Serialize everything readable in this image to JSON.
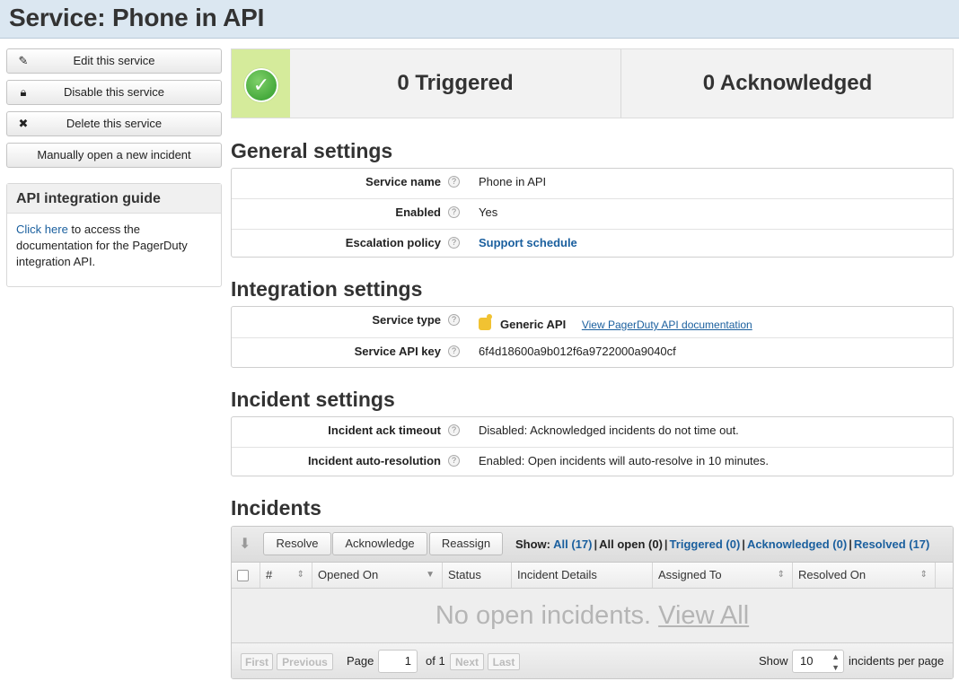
{
  "page": {
    "title": "Service: Phone in API"
  },
  "sidebar": {
    "actions": [
      {
        "label": "Edit this service",
        "icon": "pencil-icon"
      },
      {
        "label": "Disable this service",
        "icon": "lock-icon"
      },
      {
        "label": "Delete this service",
        "icon": "x-icon"
      },
      {
        "label": "Manually open a new incident",
        "icon": ""
      }
    ],
    "guide": {
      "title": "API integration guide",
      "link_text": "Click here",
      "text": " to access the documentation for the PagerDuty integration API."
    }
  },
  "status": {
    "icon": "checkmark-icon",
    "triggered": "0 Triggered",
    "acknowledged": "0 Acknowledged"
  },
  "general": {
    "heading": "General settings",
    "rows": [
      {
        "label": "Service name",
        "value": "Phone in API"
      },
      {
        "label": "Enabled",
        "value": "Yes"
      },
      {
        "label": "Escalation policy",
        "value": "Support schedule"
      }
    ]
  },
  "integration": {
    "heading": "Integration settings",
    "rows": [
      {
        "label": "Service type",
        "value": "Generic API",
        "link": "View PagerDuty API documentation"
      },
      {
        "label": "Service API key",
        "value": "6f4d18600a9b012f6a9722000a9040cf"
      }
    ]
  },
  "incident_settings": {
    "heading": "Incident settings",
    "rows": [
      {
        "label": "Incident ack timeout",
        "value": "Disabled: Acknowledged incidents do not time out."
      },
      {
        "label": "Incident auto-resolution",
        "value": "Enabled: Open incidents will auto-resolve in 10 minutes."
      }
    ]
  },
  "incidents": {
    "heading": "Incidents",
    "buttons": {
      "resolve": "Resolve",
      "acknowledge": "Acknowledge",
      "reassign": "Reassign"
    },
    "show": {
      "label": "Show:",
      "all": "All (17)",
      "all_open": "All open (0)",
      "triggered": "Triggered (0)",
      "acknowledged": "Acknowledged (0)",
      "resolved": "Resolved (17)"
    },
    "columns": [
      "#",
      "Opened On",
      "Status",
      "Incident Details",
      "Assigned To",
      "Resolved On"
    ],
    "empty_text": "No open incidents.",
    "view_all": "View All",
    "pager": {
      "first": "First",
      "previous": "Previous",
      "page_label": "Page",
      "page": "1",
      "of": "of 1",
      "next": "Next",
      "last": "Last",
      "show_label": "Show",
      "per_page": "10",
      "per_page_label": "incidents per page"
    }
  }
}
